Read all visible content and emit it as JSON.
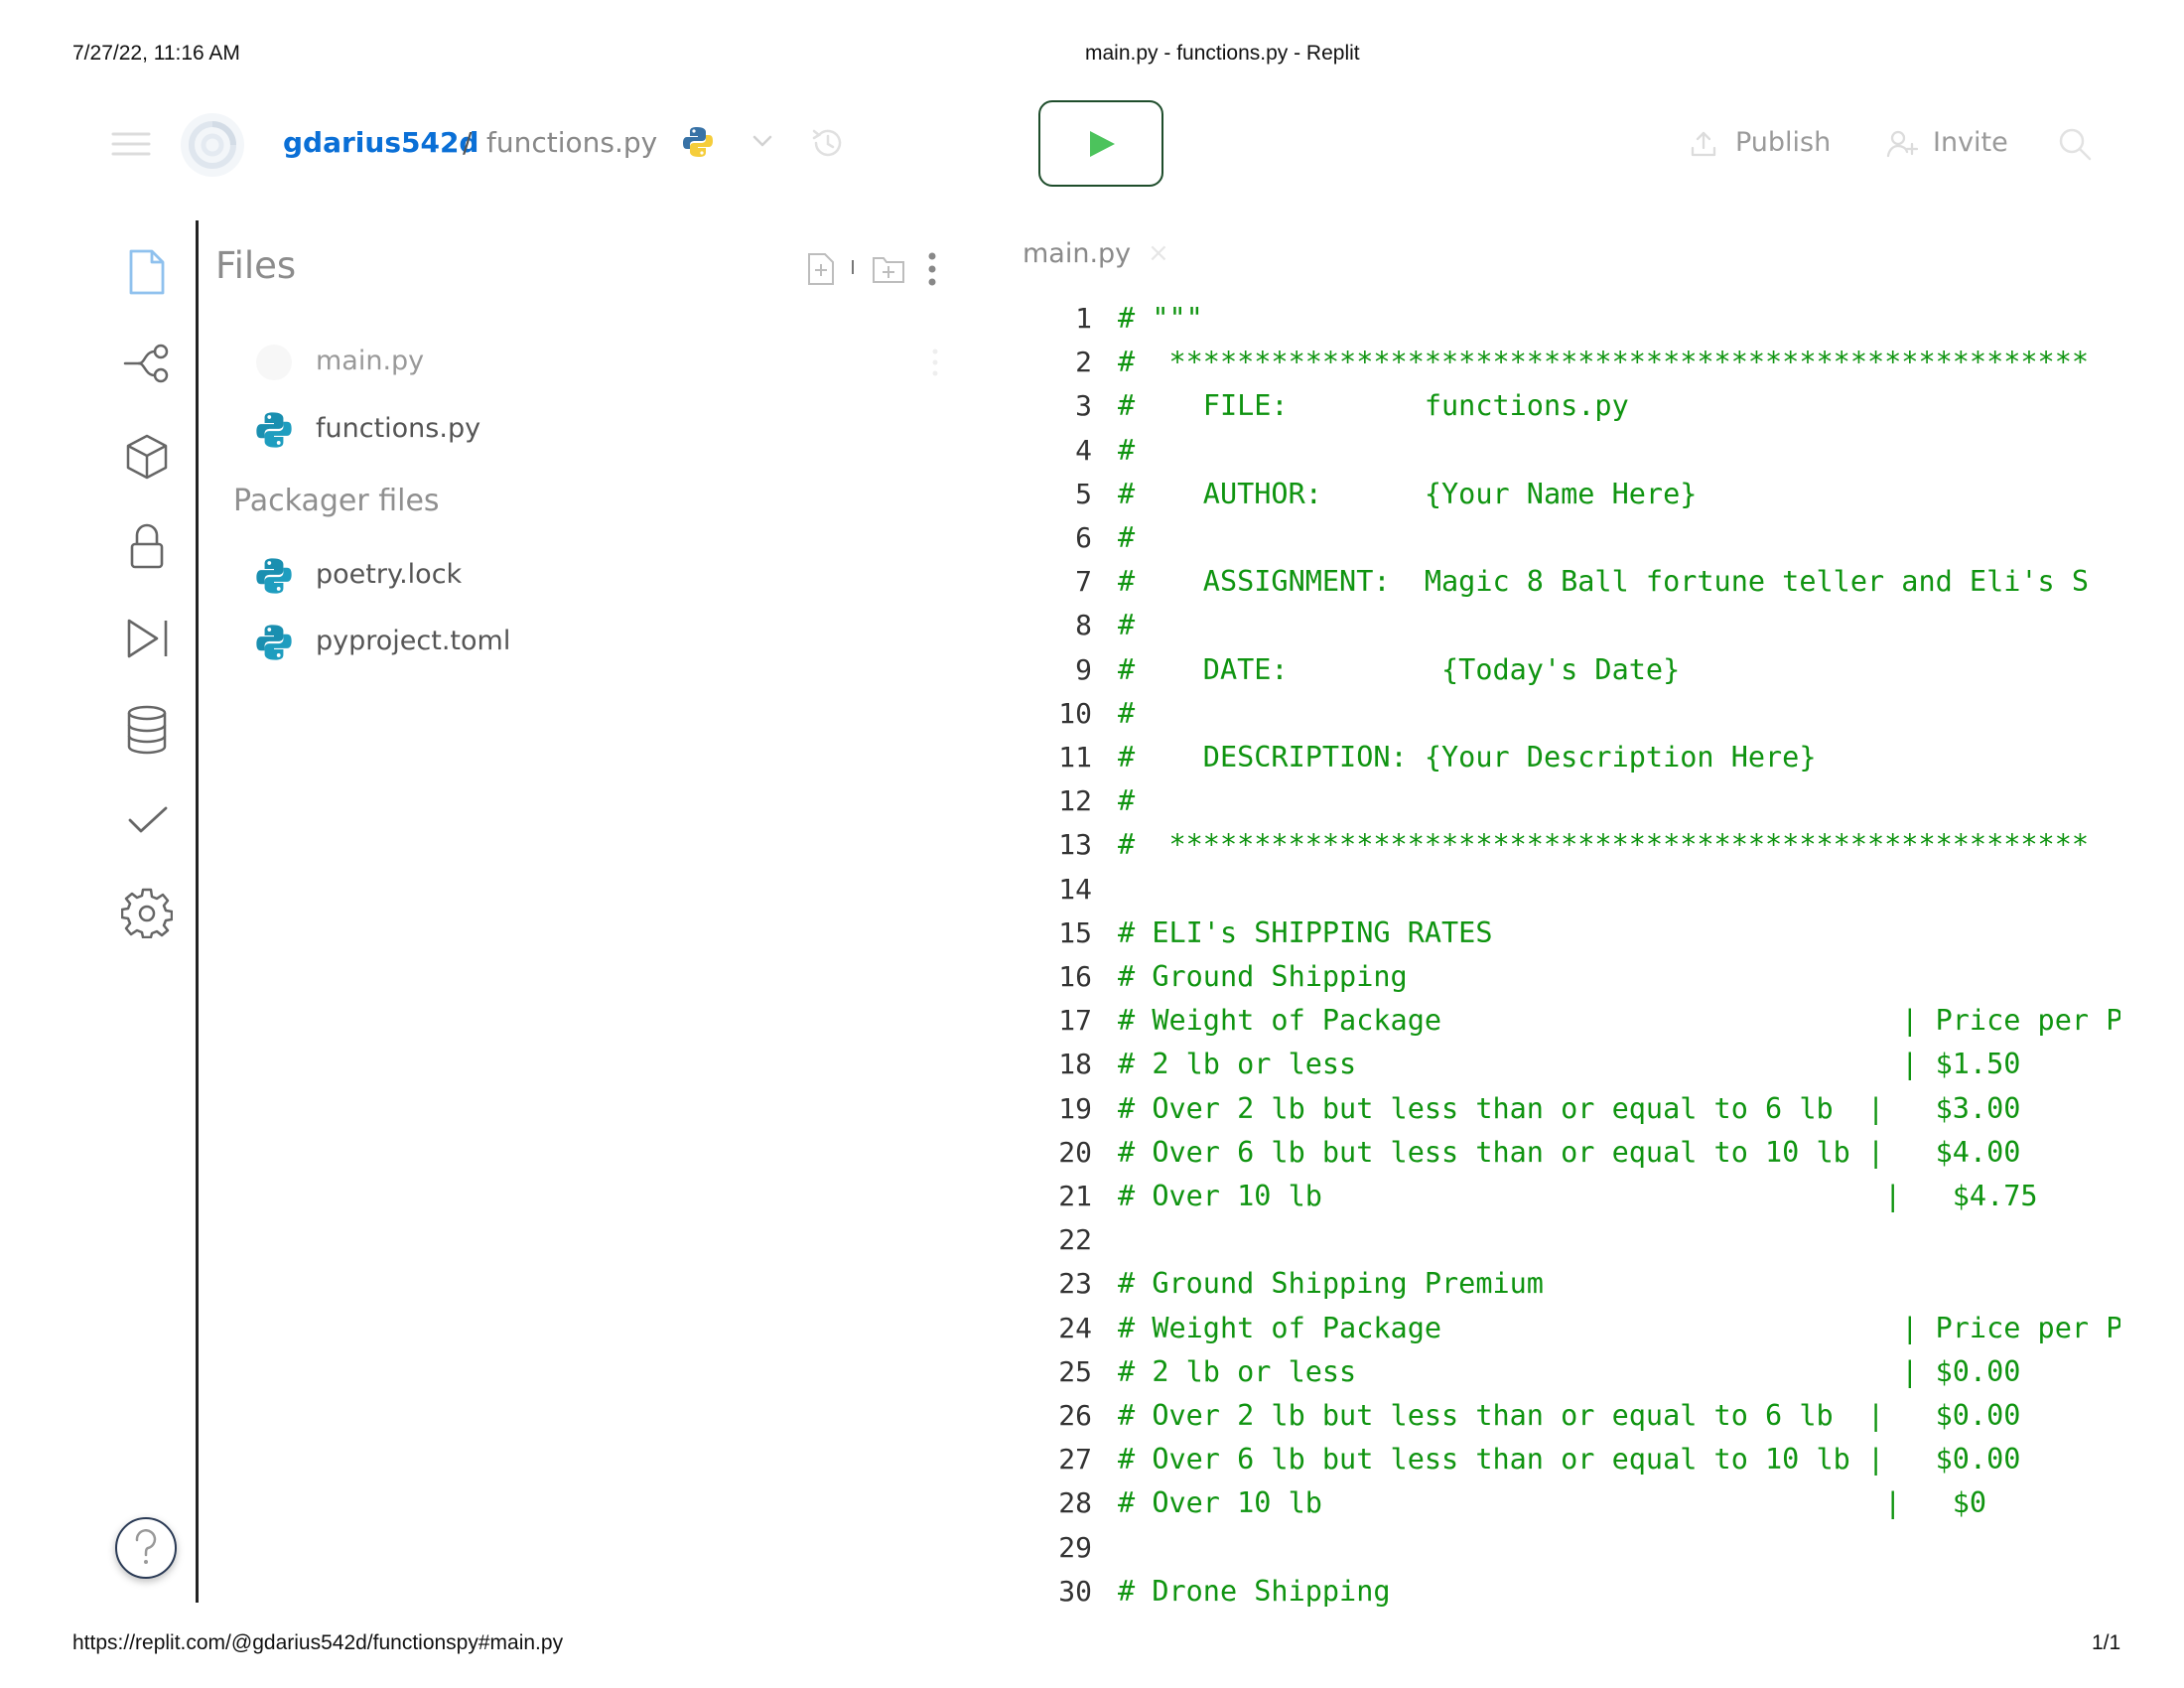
{
  "print_header": {
    "datetime": "7/27/22, 11:16 AM",
    "page_title": "main.py - functions.py - Replit"
  },
  "print_footer": {
    "url": "https://replit.com/@gdarius542d/functionspy#main.py",
    "page_count": "1/1"
  },
  "topbar": {
    "username": "gdarius542d",
    "separator": "/",
    "repl_name": "functions.py",
    "publish_label": "Publish",
    "invite_label": "Invite",
    "icons": [
      "menu-icon",
      "replit-logo-icon",
      "python-icon",
      "chevron-down-icon",
      "history-icon",
      "run-icon",
      "publish-icon",
      "invite-icon",
      "search-icon"
    ]
  },
  "sidebar": {
    "icons": [
      "files-icon",
      "version-control-icon",
      "packages-icon",
      "secrets-icon",
      "debugger-icon",
      "database-icon",
      "unit-tests-icon",
      "settings-icon",
      "help-icon"
    ]
  },
  "files_panel": {
    "title": "Files",
    "files": [
      {
        "name": "main.py"
      },
      {
        "name": "functions.py"
      }
    ],
    "packager_title": "Packager files",
    "packager_files": [
      {
        "name": "poetry.lock"
      },
      {
        "name": "pyproject.toml"
      }
    ]
  },
  "editor": {
    "tab_label": "main.py",
    "tab_close": "×",
    "lines": [
      "# \"\"\"",
      "#  ******************************************************",
      "#    FILE:        functions.py",
      "#",
      "#    AUTHOR:      {Your Name Here}",
      "#",
      "#    ASSIGNMENT:  Magic 8 Ball fortune teller and Eli's S",
      "#",
      "#    DATE:         {Today's Date}",
      "#",
      "#    DESCRIPTION: {Your Description Here}",
      "#",
      "#  ******************************************************",
      "",
      "# ELI's SHIPPING RATES",
      "# Ground Shipping",
      "# Weight of Package                           | Price per P",
      "# 2 lb or less                                | $1.50",
      "# Over 2 lb but less than or equal to 6 lb  |   $3.00",
      "# Over 6 lb but less than or equal to 10 lb |   $4.00",
      "# Over 10 lb                                 |   $4.75",
      "",
      "# Ground Shipping Premium",
      "# Weight of Package                           | Price per P",
      "# 2 lb or less                                | $0.00",
      "# Over 2 lb but less than or equal to 6 lb  |   $0.00",
      "# Over 6 lb but less than or equal to 10 lb |   $0.00",
      "# Over 10 lb                                 |   $0",
      "",
      "# Drone Shipping"
    ]
  }
}
